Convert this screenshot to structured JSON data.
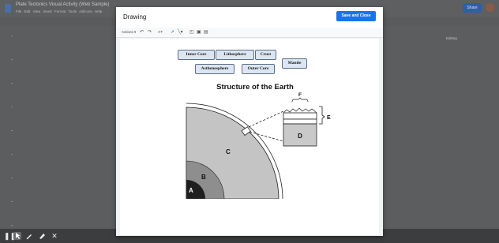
{
  "document": {
    "title": "Plate Tectonics Visual Activity (Web Sample)",
    "menu": [
      "File",
      "Edit",
      "View",
      "Insert",
      "Format",
      "Tools",
      "Add-ons",
      "Help"
    ],
    "share_label": "Share",
    "mode_label": "Editing"
  },
  "dialog": {
    "title": "Drawing",
    "save_close_label": "Save and Close",
    "toolbar": {
      "actions_label": "Actions"
    }
  },
  "labels": [
    {
      "id": "inner-core",
      "text": "Inner Core"
    },
    {
      "id": "lithosphere",
      "text": "Lithosphere"
    },
    {
      "id": "crust",
      "text": "Crust"
    },
    {
      "id": "mantle",
      "text": "Mantle"
    },
    {
      "id": "asthenosphere",
      "text": "Asthenosphere"
    },
    {
      "id": "outer-core",
      "text": "Outer Core"
    }
  ],
  "diagram": {
    "title": "Structure of the Earth",
    "letters": [
      "A",
      "B",
      "C",
      "D",
      "E",
      "F"
    ],
    "colors": {
      "inner_core": "#1f1f1f",
      "outer_core": "#8e8e8e",
      "mantle": "#c4c4c4",
      "crust_outline": "#222222"
    }
  },
  "icons": [
    "undo-icon",
    "redo-icon",
    "zoom-icon",
    "select-icon",
    "line-icon",
    "shape-icon",
    "textbox-icon",
    "image-icon",
    "pointer-icon",
    "pen-icon",
    "highlighter-icon",
    "close-icon"
  ]
}
